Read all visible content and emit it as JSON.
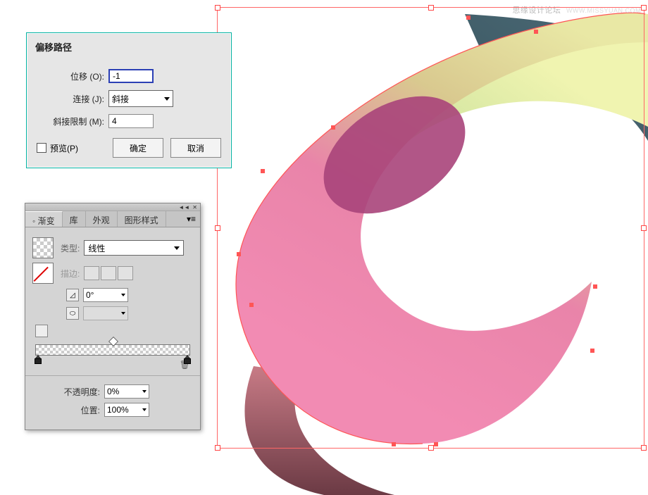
{
  "watermark": {
    "text": "思缘设计论坛",
    "url": "WWW.MISSYUAN.COM"
  },
  "dialog": {
    "title": "偏移路径",
    "offset_label": "位移 (O):",
    "offset_value": "-1",
    "join_label": "连接 (J):",
    "join_value": "斜接",
    "limit_label": "斜接限制 (M):",
    "limit_value": "4",
    "preview_label": "预览(P)",
    "ok_label": "确定",
    "cancel_label": "取消"
  },
  "gradient_panel": {
    "tabs": {
      "gradient": "◦ 渐变",
      "library": "库",
      "appearance": "外观",
      "graphic_styles": "图形样式"
    },
    "type_label": "类型:",
    "type_value": "线性",
    "stroke_label": "描边:",
    "angle_label": "0°",
    "opacity_label": "不透明度:",
    "opacity_value": "0%",
    "location_label": "位置:",
    "location_value": "100%"
  }
}
